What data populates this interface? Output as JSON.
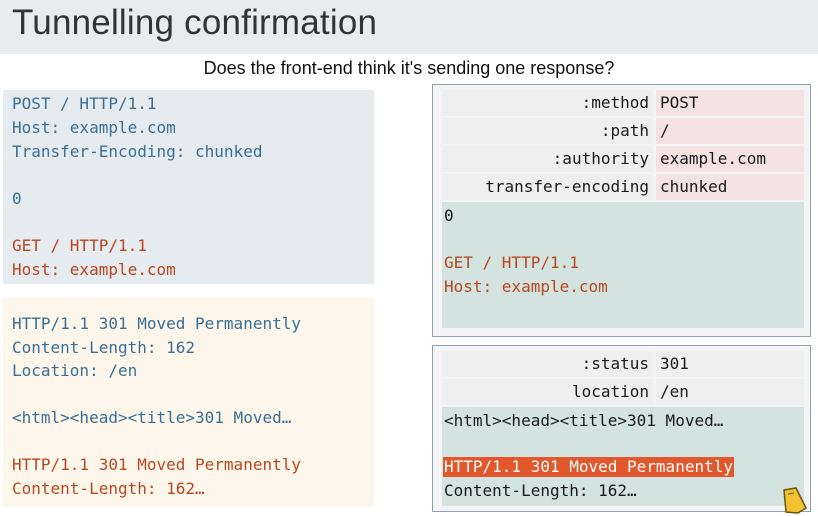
{
  "slide": {
    "title": "Tunnelling confirmation",
    "subtitle": "Does the front-end think it's sending one response?"
  },
  "left_request": {
    "lines": [
      "POST / HTTP/1.1",
      "Host: example.com",
      "Transfer-Encoding: chunked",
      "",
      "0",
      "",
      "GET / HTTP/1.1",
      "Host: example.com"
    ]
  },
  "left_response": {
    "lines": [
      "HTTP/1.1 301 Moved Permanently",
      "Content-Length: 162",
      "Location: /en",
      "",
      "<html><head><title>301 Moved…",
      "",
      "HTTP/1.1 301 Moved Permanently",
      "Content-Length: 162…"
    ]
  },
  "right_request": {
    "headers": [
      {
        "name": ":method",
        "value": "POST"
      },
      {
        "name": ":path",
        "value": "/"
      },
      {
        "name": ":authority",
        "value": "example.com"
      },
      {
        "name": "transfer-encoding",
        "value": "chunked"
      }
    ],
    "body_lines": [
      "0",
      "",
      "GET / HTTP/1.1",
      "Host: example.com"
    ]
  },
  "right_response": {
    "headers": [
      {
        "name": ":status",
        "value": "301"
      },
      {
        "name": "location",
        "value": "/en"
      }
    ],
    "body_lines": [
      "<html><head><title>301 Moved…",
      "",
      "HTTP/1.1 301 Moved Permanently",
      "Content-Length: 162…"
    ]
  },
  "colors": {
    "blue_text": "#3a6f96",
    "red_text": "#b8471f",
    "highlight": "#e2572c"
  },
  "icons": [
    "hand-pointer-icon"
  ]
}
